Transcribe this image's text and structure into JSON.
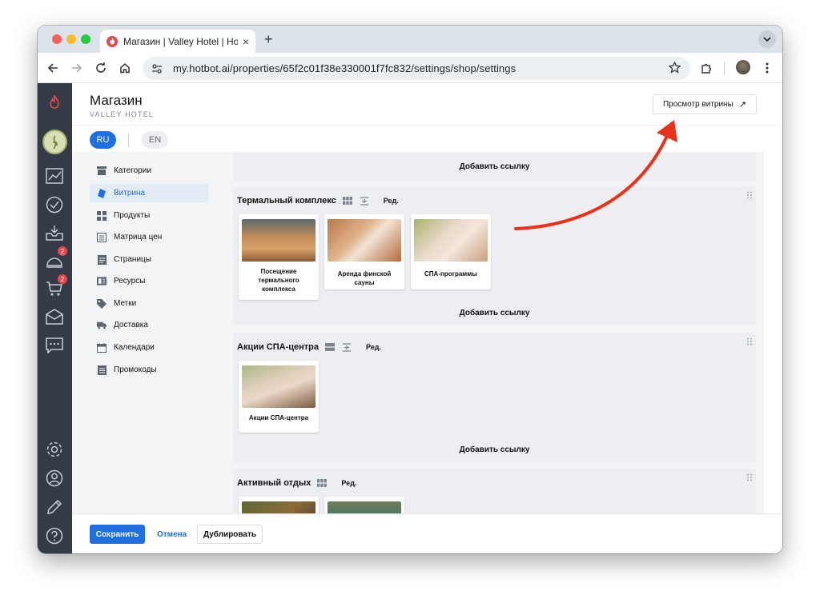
{
  "browser": {
    "tab_title": "Магазин | Valley Hotel | Hotbot",
    "tab_close": "×",
    "new_tab": "+",
    "url": "my.hotbot.ai/properties/65f2c01f38e330001f7fc832/settings/shop/settings"
  },
  "rail": {
    "badges": {
      "bell": "2",
      "cart": "2"
    }
  },
  "header": {
    "title": "Магазин",
    "subtitle": "VALLEY HOTEL",
    "preview_button": "Просмотр витрины",
    "preview_arrow": "↗",
    "lang_ru": "RU",
    "lang_en": "EN"
  },
  "sidebar": {
    "items": [
      {
        "label": "Категории",
        "icon": "store-icon"
      },
      {
        "label": "Витрина",
        "icon": "tag-blue-icon"
      },
      {
        "label": "Продукты",
        "icon": "grid-icon"
      },
      {
        "label": "Матрица цен",
        "icon": "calculator-icon"
      },
      {
        "label": "Страницы",
        "icon": "page-icon"
      },
      {
        "label": "Ресурсы",
        "icon": "resources-icon"
      },
      {
        "label": "Метки",
        "icon": "label-icon"
      },
      {
        "label": "Доставка",
        "icon": "truck-icon"
      },
      {
        "label": "Календари",
        "icon": "calendar-icon"
      },
      {
        "label": "Промокоды",
        "icon": "promo-icon"
      }
    ]
  },
  "content": {
    "add_link": "Добавить ссылку",
    "edit_label": "Ред.",
    "blocks": [
      {
        "title": "Термальный комплекс",
        "cards": [
          {
            "label": "Посещение термального комплекса"
          },
          {
            "label": "Аренда финской сауны"
          },
          {
            "label": "СПА-программы"
          }
        ]
      },
      {
        "title": "Акции СПА-центра",
        "cards": [
          {
            "label": "Акции СПА-центра"
          }
        ]
      },
      {
        "title": "Активный отдых",
        "cards": []
      }
    ]
  },
  "footer": {
    "save": "Сохранить",
    "cancel": "Отмена",
    "duplicate": "Дублировать"
  },
  "colors": {
    "accent": "#1f6fe0",
    "rail": "#343a46",
    "annotation_arrow": "#e8321c"
  }
}
